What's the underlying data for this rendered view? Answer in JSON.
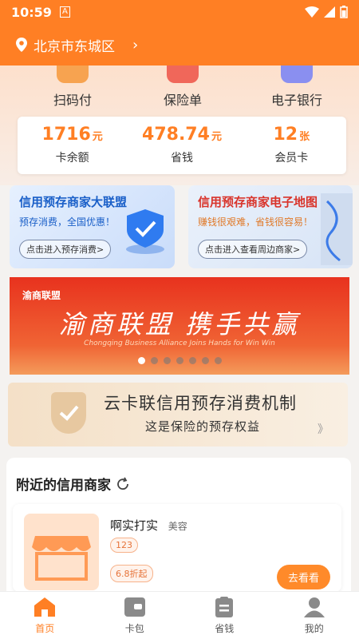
{
  "status_bar": {
    "time": "10:59",
    "badge": "A"
  },
  "header": {
    "location": "北京市东城区"
  },
  "quick_actions": [
    {
      "label": "扫码付",
      "icon": "scan-pay-icon"
    },
    {
      "label": "保险单",
      "icon": "insurance-icon"
    },
    {
      "label": "电子银行",
      "icon": "ebank-icon"
    }
  ],
  "stats": [
    {
      "value": "1716",
      "unit": "元",
      "label": "卡余额"
    },
    {
      "value": "478.74",
      "unit": "元",
      "label": "省钱"
    },
    {
      "value": "12",
      "unit": "张",
      "label": "会员卡"
    }
  ],
  "promos": [
    {
      "title": "信用预存商家大联盟",
      "subtitle": "预存消费，全国优惠！",
      "button": "点击进入预存消费>"
    },
    {
      "title": "信用预存商家电子地图",
      "subtitle": "赚钱很艰难，省钱很容易！",
      "button": "点击进入查看周边商家>"
    }
  ],
  "banner": {
    "brand": "渝商联盟",
    "slogan": "渝商联盟 携手共赢",
    "slogan_en": "Chongqing Business Alliance Joins Hands for Win Win",
    "slide_count": 7,
    "active_slide": 0
  },
  "mechanism": {
    "title": "云卡联信用预存消费机制",
    "subtitle": "这是保险的预存权益",
    "arrows": "》"
  },
  "nearby": {
    "heading": "附近的信用商家",
    "shop": {
      "name": "啊实打实",
      "category": "美容",
      "tag_code": "123",
      "tag_discount": "6.8折起",
      "go_button": "去看看"
    }
  },
  "tabs": [
    {
      "label": "首页",
      "active": true
    },
    {
      "label": "卡包",
      "active": false
    },
    {
      "label": "省钱",
      "active": false
    },
    {
      "label": "我的",
      "active": false
    }
  ],
  "colors": {
    "brand_orange": "#ff7f24",
    "promo_blue": "#1a5fc8",
    "promo_red": "#d9342b"
  }
}
